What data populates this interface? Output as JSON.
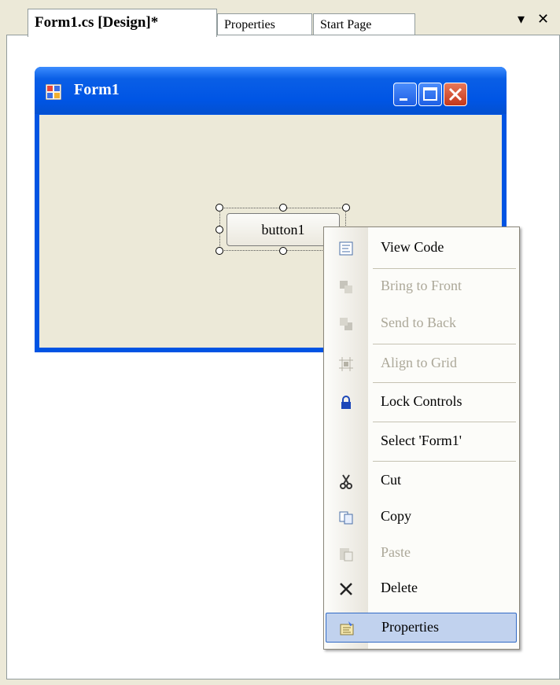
{
  "tabs": {
    "active": "Form1.cs [Design]*",
    "items": [
      "Properties",
      "Start Page"
    ],
    "dropdown_glyph": "▾",
    "close_glyph": "✕"
  },
  "form": {
    "title": "Form1",
    "button_label": "button1"
  },
  "context_menu": {
    "view_code": "View Code",
    "bring_to_front": "Bring to Front",
    "send_to_back": "Send to Back",
    "align_to_grid": "Align to Grid",
    "lock_controls": "Lock Controls",
    "select_form": "Select 'Form1'",
    "cut": "Cut",
    "copy": "Copy",
    "paste": "Paste",
    "delete": "Delete",
    "properties": "Properties"
  },
  "colors": {
    "titlebar": "#0055e5",
    "highlight": "#c1d2ee",
    "disabled_text": "#aca899"
  }
}
